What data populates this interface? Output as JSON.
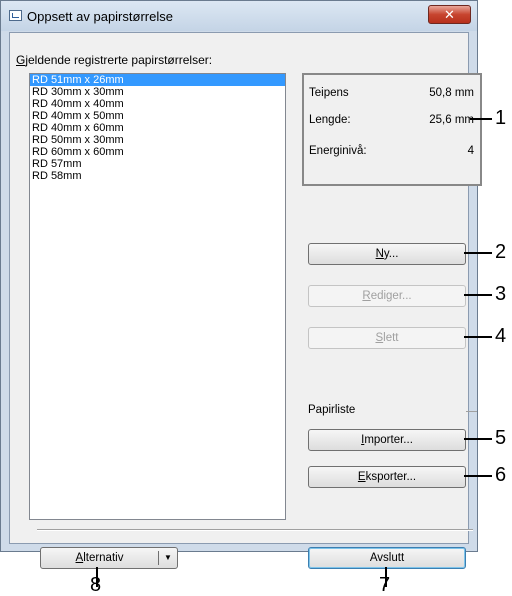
{
  "window": {
    "title": "Oppsett av papirstørrelse",
    "close_glyph": "✕",
    "icon": "app-icon"
  },
  "list": {
    "label_mnemonic": "G",
    "label_rest": "jeldende registrerte papirstørrelser:",
    "items": [
      "RD 51mm x 26mm",
      "RD 30mm x 30mm",
      "RD 40mm x 40mm",
      "RD 40mm x 50mm",
      "RD 40mm x 60mm",
      "RD 50mm x 30mm",
      "RD 60mm x 60mm",
      "RD 57mm",
      "RD 58mm"
    ],
    "selected_index": 0
  },
  "info": {
    "rows": [
      {
        "label": "Teipens",
        "value": "50,8 mm"
      },
      {
        "label": "Lengde:",
        "value": "25,6 mm"
      },
      {
        "label": "Energinivå:",
        "value": "4"
      }
    ]
  },
  "buttons": {
    "new": {
      "mnemonic": "N",
      "rest": "y...",
      "enabled": true
    },
    "edit": {
      "mnemonic": "R",
      "rest": "ediger...",
      "enabled": false
    },
    "delete": {
      "mnemonic": "S",
      "rest": "lett",
      "enabled": false
    },
    "import": {
      "mnemonic": "I",
      "rest": "mporter...",
      "enabled": true
    },
    "export": {
      "mnemonic": "E",
      "rest": "ksporter...",
      "enabled": true
    },
    "options": {
      "mnemonic": "A",
      "rest": "lternativ",
      "dropdown_glyph": "▼"
    },
    "exit": {
      "label": "Avslutt"
    }
  },
  "paper_list_label": "Papirliste",
  "callouts": [
    "1",
    "2",
    "3",
    "4",
    "5",
    "6",
    "7",
    "8"
  ]
}
